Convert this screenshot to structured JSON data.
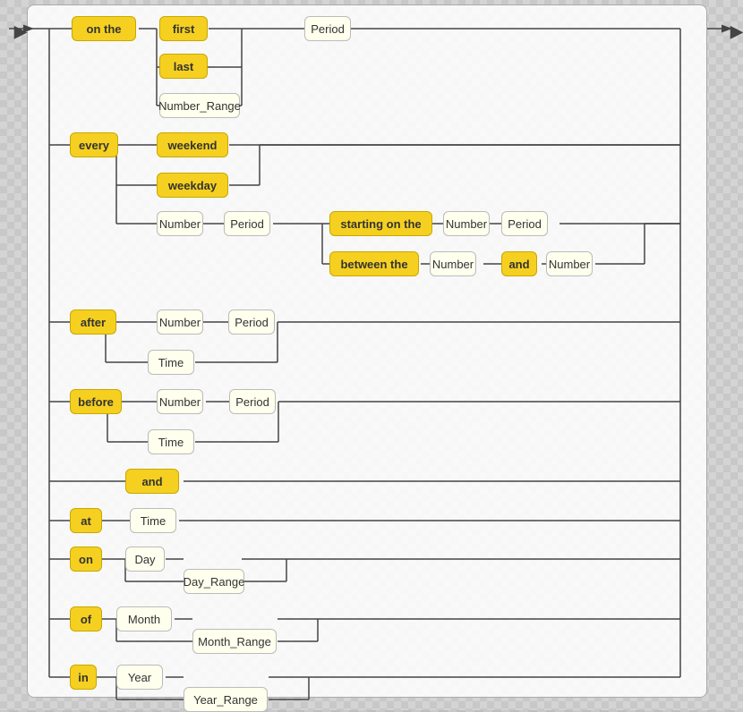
{
  "tokens": {
    "on_the": "on the",
    "first": "first",
    "last": "last",
    "number_range": "Number_Range",
    "period1": "Period",
    "every": "every",
    "weekend": "weekend",
    "weekday": "weekday",
    "number1": "Number",
    "period2": "Period",
    "starting_on_the": "starting on the",
    "number2": "Number",
    "period3": "Period",
    "between_the": "between the",
    "number3": "Number",
    "and1": "and",
    "number4": "Number",
    "after": "after",
    "number5": "Number",
    "period4": "Period",
    "time1": "Time",
    "before": "before",
    "number6": "Number",
    "period5": "Period",
    "time2": "Time",
    "and2": "and",
    "at": "at",
    "time3": "Time",
    "on": "on",
    "day": "Day",
    "day_range": "Day_Range",
    "of": "of",
    "month": "Month",
    "month_range": "Month_Range",
    "in": "in",
    "year": "Year",
    "year_range": "Year_Range"
  }
}
